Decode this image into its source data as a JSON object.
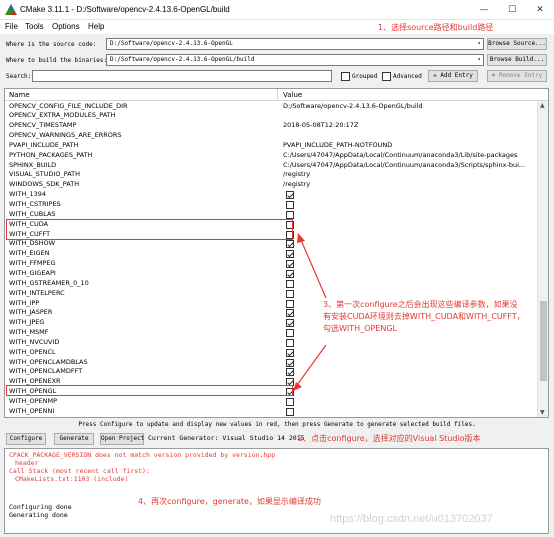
{
  "window": {
    "title": "CMake 3.11.1 - D:/Software/opencv-2.4.13.6-OpenGL/build",
    "minimize": "—",
    "maximize": "☐",
    "close": "✕"
  },
  "menu": [
    "File",
    "Tools",
    "Options",
    "Help"
  ],
  "source": {
    "label": "Where is the source code:",
    "value": "D:/Software/opencv-2.4.13.6-OpenGL",
    "browse": "Browse Source..."
  },
  "build": {
    "label": "Where to build the binaries:",
    "value": "D:/Software/opencv-2.4.13.6-OpenGL/build",
    "browse": "Browse Build..."
  },
  "search": {
    "label": "Search:",
    "value": "",
    "grouped": "Grouped",
    "advanced": "Advanced",
    "add_entry": "Add Entry",
    "remove_entry": "Remove Entry"
  },
  "table": {
    "col_name": "Name",
    "col_value": "Value",
    "rows": [
      {
        "name": "OPENCV_CONFIG_FILE_INCLUDE_DIR",
        "value": "D:/Software/opencv-2.4.13.6-OpenGL/build"
      },
      {
        "name": "OPENCV_EXTRA_MODULES_PATH",
        "value": ""
      },
      {
        "name": "OPENCV_TIMESTAMP",
        "value": "2018-05-08T12:20:17Z"
      },
      {
        "name": "OPENCV_WARNINGS_ARE_ERRORS",
        "value": ""
      },
      {
        "name": "PVAPI_INCLUDE_PATH",
        "value": "PVAPI_INCLUDE_PATH-NOTFOUND"
      },
      {
        "name": "PYTHON_PACKAGES_PATH",
        "value": "C:/Users/47047/AppData/Local/Continuum/anaconda3/Lib/site-packages"
      },
      {
        "name": "SPHINX_BUILD",
        "value": "C:/Users/47047/AppData/Local/Continuum/anaconda3/Scripts/sphinx-bui..."
      },
      {
        "name": "VISUAL_STUDIO_PATH",
        "value": "/registry"
      },
      {
        "name": "WINDOWS_SDK_PATH",
        "value": "/registry"
      },
      {
        "name": "WITH_1394",
        "checked": true
      },
      {
        "name": "WITH_CSTRIPES",
        "checked": false
      },
      {
        "name": "WITH_CUBLAS",
        "checked": false
      },
      {
        "name": "WITH_CUDA",
        "checked": false
      },
      {
        "name": "WITH_CUFFT",
        "checked": false
      },
      {
        "name": "WITH_DSHOW",
        "checked": true
      },
      {
        "name": "WITH_EIGEN",
        "checked": true
      },
      {
        "name": "WITH_FFMPEG",
        "checked": true
      },
      {
        "name": "WITH_GIGEAPI",
        "checked": true
      },
      {
        "name": "WITH_GSTREAMER_0_10",
        "checked": false
      },
      {
        "name": "WITH_INTELPERC",
        "checked": false
      },
      {
        "name": "WITH_IPP",
        "checked": false
      },
      {
        "name": "WITH_JASPER",
        "checked": true
      },
      {
        "name": "WITH_JPEG",
        "checked": true
      },
      {
        "name": "WITH_MSMF",
        "checked": false
      },
      {
        "name": "WITH_NVCUVID",
        "checked": false
      },
      {
        "name": "WITH_OPENCL",
        "checked": true
      },
      {
        "name": "WITH_OPENCLAMDBLAS",
        "checked": true
      },
      {
        "name": "WITH_OPENCLAMDFFT",
        "checked": true
      },
      {
        "name": "WITH_OPENEXR",
        "checked": true
      },
      {
        "name": "WITH_OPENGL",
        "checked": true
      },
      {
        "name": "WITH_OPENMP",
        "checked": false
      },
      {
        "name": "WITH_OPENNI",
        "checked": false
      }
    ]
  },
  "status_hint": "Press Configure to update and display new values in red, then press Generate to generate selected build files.",
  "bottom": {
    "configure": "Configure",
    "generate": "Generate",
    "open_project": "Open Project",
    "generator": "Current Generator: Visual Studio 14 2015"
  },
  "log": [
    {
      "text": "CPACK_PACKAGE_VERSION does not match version provided by version.hpp",
      "color": "red"
    },
    {
      "text": "header",
      "color": "red"
    },
    {
      "text": "Call Stack (most recent call first):",
      "color": "red"
    },
    {
      "text": "CMakeLists.txt:1103 (include)",
      "color": "red"
    },
    {
      "text": "Configuring done",
      "color": "black"
    },
    {
      "text": "Generating done",
      "color": "black"
    }
  ],
  "annotations": {
    "a1": "1、选择source路径和build路径",
    "a2": "2、点击configure，选择对应的Visual Studio版本",
    "a3_line1": "3、第一次configure之后会出现这些编译参数，如果没",
    "a3_line2": "有安装CUDA环境则去掉WITH_CUDA和WITH_CUFFT，",
    "a3_line3": "勾选WITH_OPENGL",
    "a4": "4、再次configure，generate，如果显示编译成功"
  },
  "watermark": "https://blog.csdn.net/u013702037",
  "colors": {
    "annotation": "#e53935"
  },
  "icons": [
    "cmake-app-icon",
    "add-entry-icon",
    "remove-entry-icon"
  ]
}
